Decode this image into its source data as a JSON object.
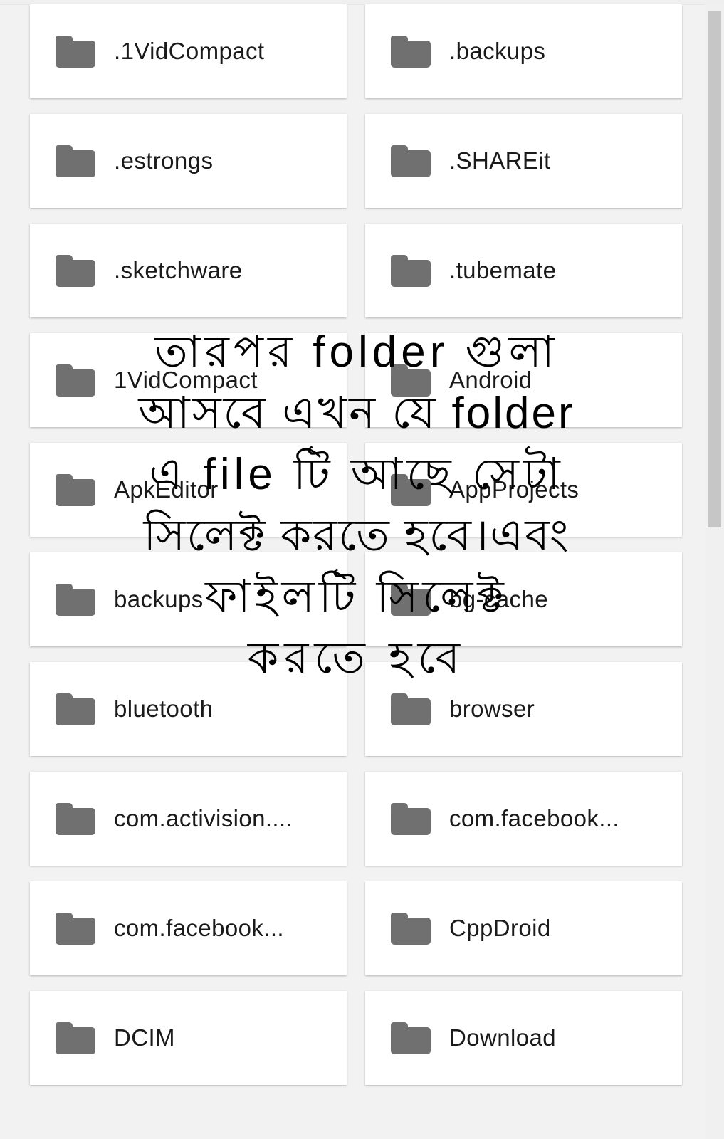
{
  "app": {
    "screen_name": "file-manager-folder-grid",
    "background_color": "#f2f2f2",
    "card_color": "#ffffff",
    "folder_icon_color": "#707070",
    "label_color": "#1a1a1a"
  },
  "scrollbar": {
    "thumb_color": "#c6c6c6",
    "track_color": "#f0f0f0"
  },
  "grid": {
    "columns": 2,
    "icon_name": "folder-icon",
    "rows": [
      [
        {
          "name": ".1VidCompact"
        },
        {
          "name": ".backups"
        }
      ],
      [
        {
          "name": ".estrongs"
        },
        {
          "name": ".SHAREit"
        }
      ],
      [
        {
          "name": ".sketchware"
        },
        {
          "name": ".tubemate"
        }
      ],
      [
        {
          "name": "1VidCompact"
        },
        {
          "name": "Android"
        }
      ],
      [
        {
          "name": "ApkEditor"
        },
        {
          "name": "AppProjects"
        }
      ],
      [
        {
          "name": "backups"
        },
        {
          "name": "bg-cache"
        }
      ],
      [
        {
          "name": "bluetooth"
        },
        {
          "name": "browser"
        }
      ],
      [
        {
          "name": "com.activision...."
        },
        {
          "name": "com.facebook..."
        }
      ],
      [
        {
          "name": "com.facebook..."
        },
        {
          "name": "CppDroid"
        }
      ],
      [
        {
          "name": "DCIM"
        },
        {
          "name": "Download"
        }
      ]
    ]
  },
  "overlay_caption": {
    "language": "Bengali",
    "lines": [
      "তারপর folder গুলা",
      "আসবে এখন যে folder",
      "এ file টি আছে সেটা",
      "সিলেক্ট করতে হবে।এবং",
      "ফাইলটি সিলেক্ট",
      "করতে হবে"
    ],
    "full_text": "তারপর folder গুলা আসবে এখন যে folder এ file টি আছে সেটা সিলেক্ট করতে হবে।এবং ফাইলটি সিলেক্ট করতে হবে",
    "color": "#000000"
  }
}
